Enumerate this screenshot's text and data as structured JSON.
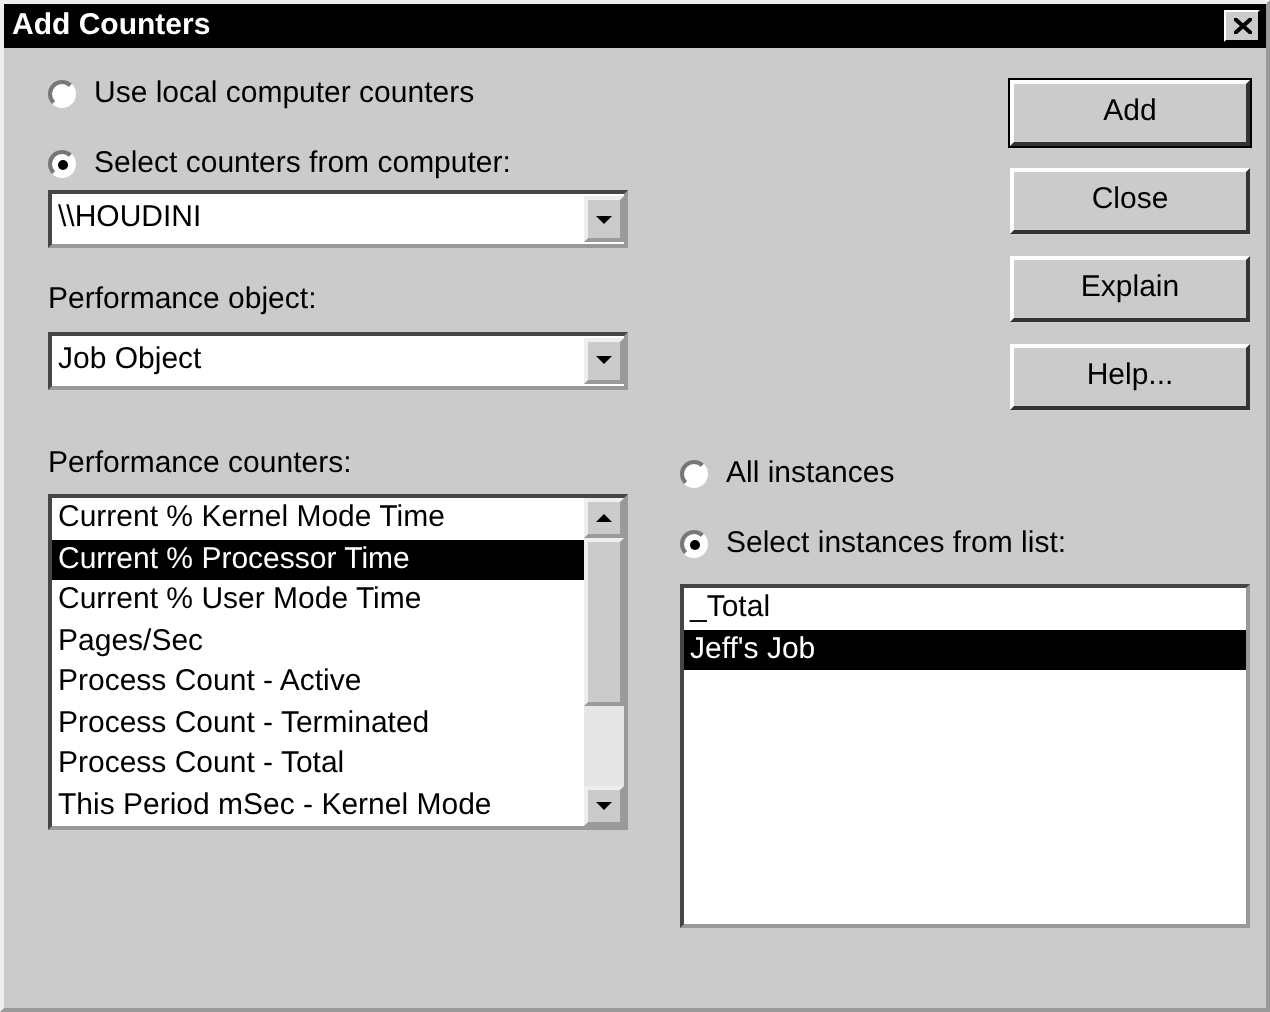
{
  "window": {
    "title": "Add Counters"
  },
  "computer_source": [
    {
      "label": "Use local computer counters",
      "selected": false
    },
    {
      "label": "Select counters from computer:",
      "selected": true
    }
  ],
  "computer": {
    "value": "\\\\HOUDINI"
  },
  "performance_object": {
    "label": "Performance object:",
    "value": "Job Object"
  },
  "counters": {
    "label": "Performance counters:",
    "items": [
      {
        "label": "Current % Kernel Mode Time",
        "selected": false
      },
      {
        "label": "Current % Processor Time",
        "selected": true
      },
      {
        "label": "Current % User Mode Time",
        "selected": false
      },
      {
        "label": "Pages/Sec",
        "selected": false
      },
      {
        "label": "Process Count - Active",
        "selected": false
      },
      {
        "label": "Process Count - Terminated",
        "selected": false
      },
      {
        "label": "Process Count - Total",
        "selected": false
      },
      {
        "label": "This Period mSec - Kernel Mode",
        "selected": false
      }
    ]
  },
  "buttons": [
    {
      "label": "Add",
      "default": true
    },
    {
      "label": "Close",
      "default": false
    },
    {
      "label": "Explain",
      "default": false
    },
    {
      "label": "Help...",
      "default": false
    }
  ],
  "instance_mode": [
    {
      "label": "All instances",
      "selected": false
    },
    {
      "label": "Select instances from list:",
      "selected": true
    }
  ],
  "instances": [
    {
      "label": "_Total",
      "selected": false
    },
    {
      "label": "Jeff's Job",
      "selected": true
    }
  ]
}
